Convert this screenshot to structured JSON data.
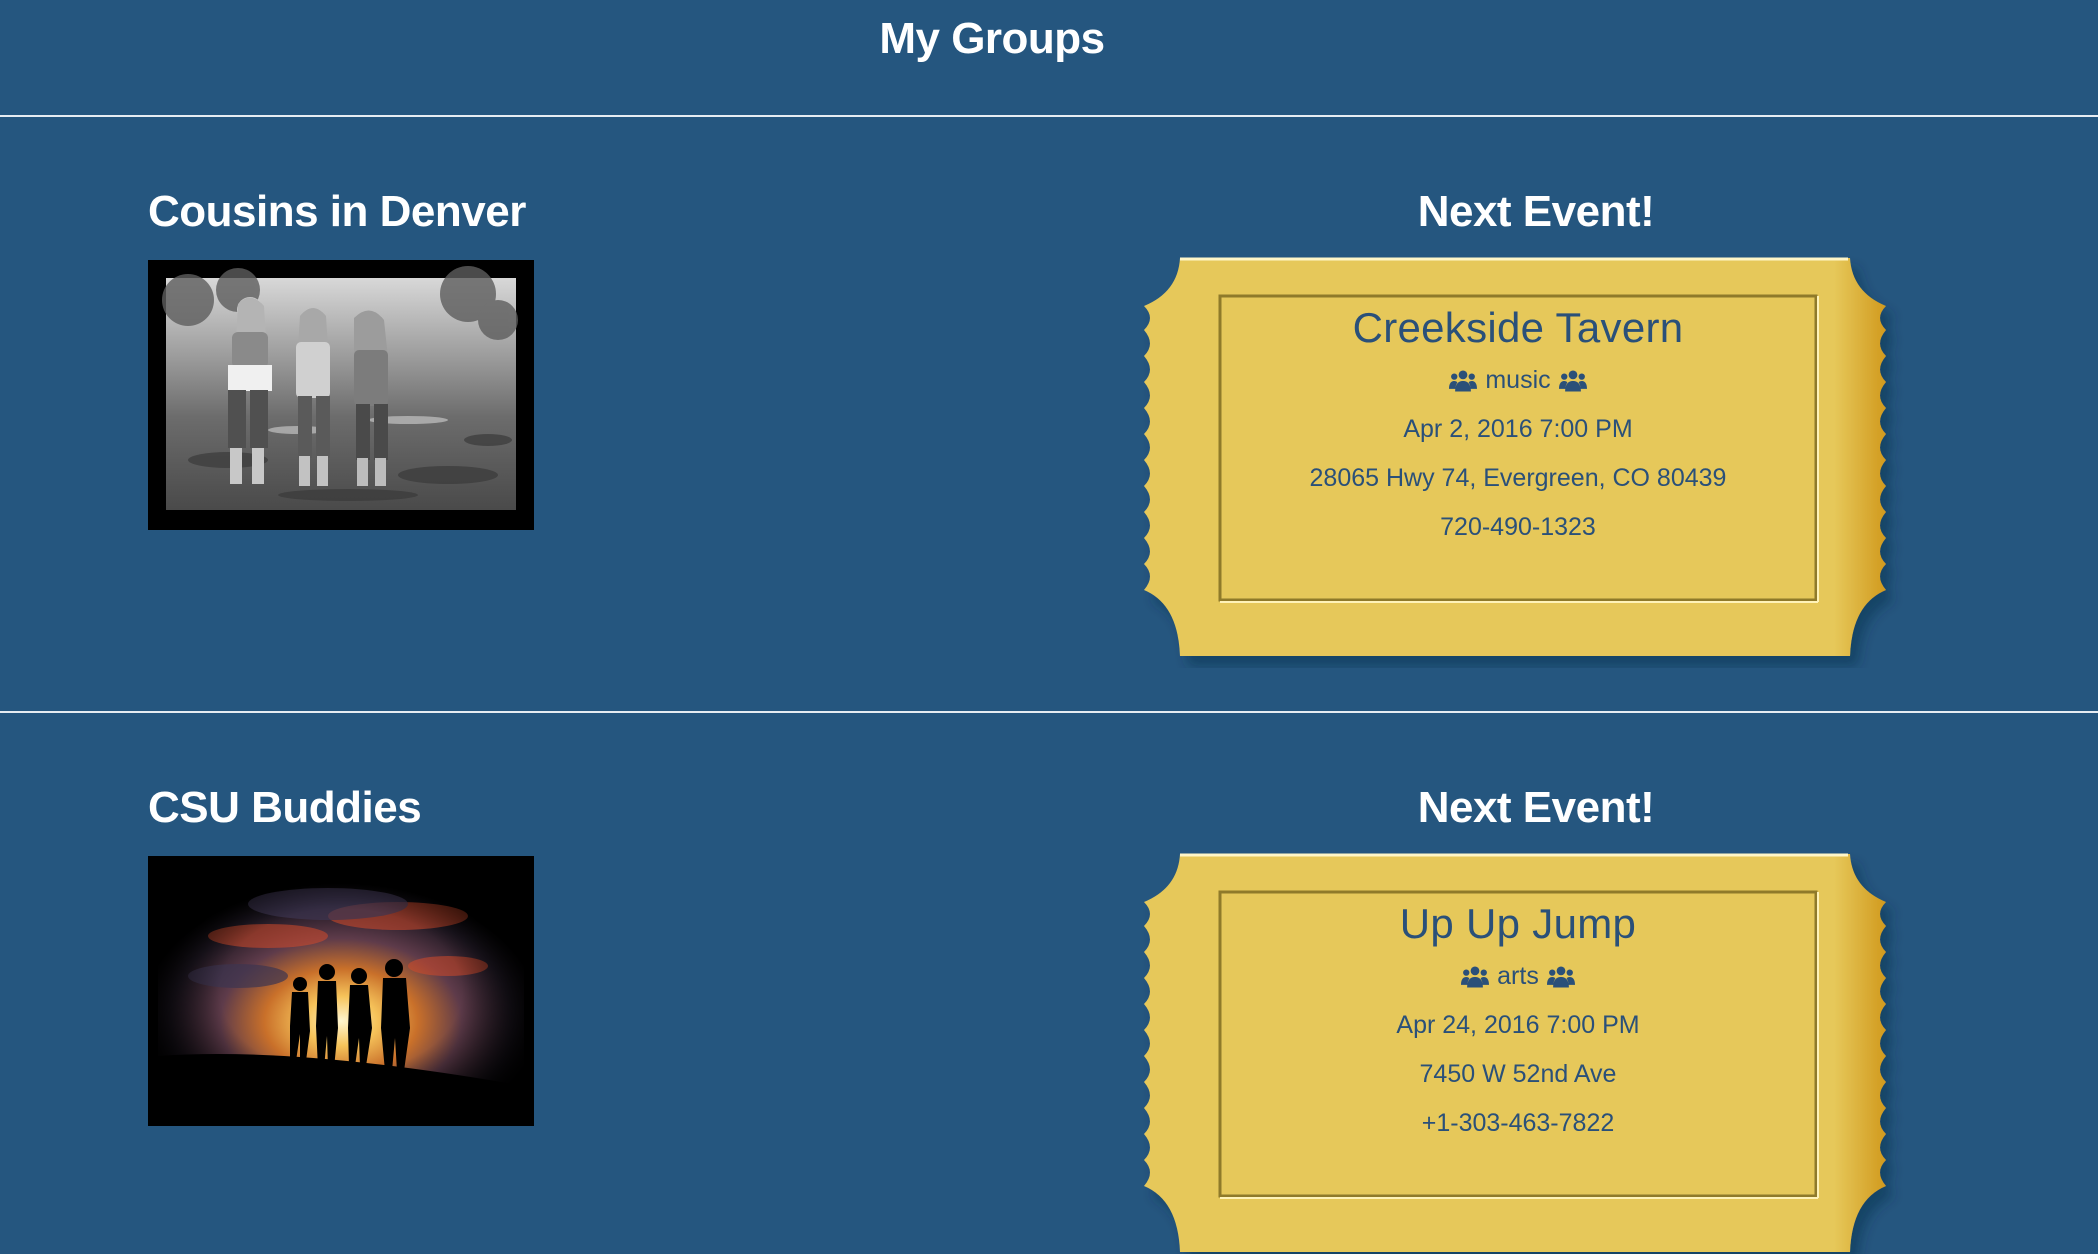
{
  "header": {
    "title": "My Groups"
  },
  "colors": {
    "background": "#25567f",
    "ticket": "#e6c85a",
    "ticket_text": "#2a5079",
    "divider": "#e6ecf2"
  },
  "groups": [
    {
      "name": "Cousins in Denver",
      "photo_icon": "group-photo-three-girls-walking",
      "next_event_label": "Next Event!",
      "event": {
        "name": "Creekside Tavern",
        "category": "music",
        "category_icon": "users-icon",
        "datetime": "Apr 2, 2016 7:00 PM",
        "address": "28065 Hwy 74, Evergreen, CO 80439",
        "phone": "720-490-1323"
      }
    },
    {
      "name": "CSU Buddies",
      "photo_icon": "group-photo-silhouettes-sunset",
      "next_event_label": "Next Event!",
      "event": {
        "name": "Up Up Jump",
        "category": "arts",
        "category_icon": "users-icon",
        "datetime": "Apr 24, 2016 7:00 PM",
        "address": "7450 W 52nd Ave",
        "phone": "+1-303-463-7822"
      }
    }
  ]
}
